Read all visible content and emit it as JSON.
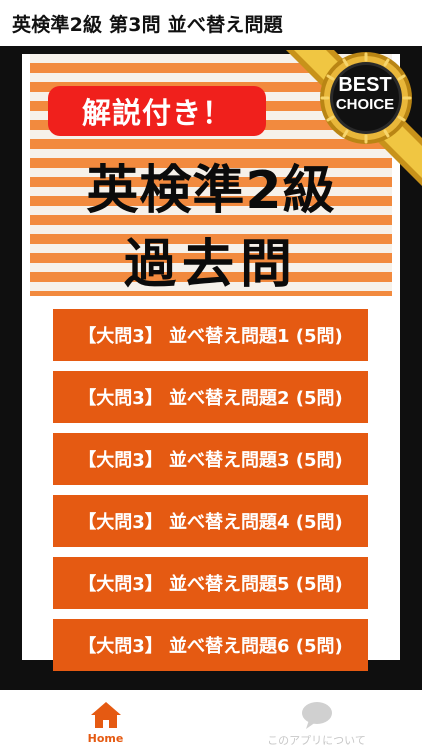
{
  "app_bar": {
    "title": "英検準2級 第3問 並べ替え問題"
  },
  "banner": {
    "tag": "解説付き！",
    "line1": "英検準2級",
    "line2": "過去問",
    "badge_top": "BEST",
    "badge_bottom": "CHOICE"
  },
  "menu": [
    {
      "label": "【大問3】 並べ替え問題1 (5問)"
    },
    {
      "label": "【大問3】 並べ替え問題2 (5問)"
    },
    {
      "label": "【大問3】 並べ替え問題3 (5問)"
    },
    {
      "label": "【大問3】 並べ替え問題4 (5問)"
    },
    {
      "label": "【大問3】 並べ替え問題5 (5問)"
    },
    {
      "label": "【大問3】 並べ替え問題6 (5問)"
    }
  ],
  "bottom_nav": {
    "home": {
      "label": "Home",
      "icon": "home-icon"
    },
    "about": {
      "label": "このアプリについて",
      "icon": "speech-bubble-icon"
    }
  },
  "colors": {
    "accent": "#e55a12",
    "tag_red": "#f0201c",
    "stripe_orange": "#f28a3e",
    "gold": "#d8a21c"
  }
}
